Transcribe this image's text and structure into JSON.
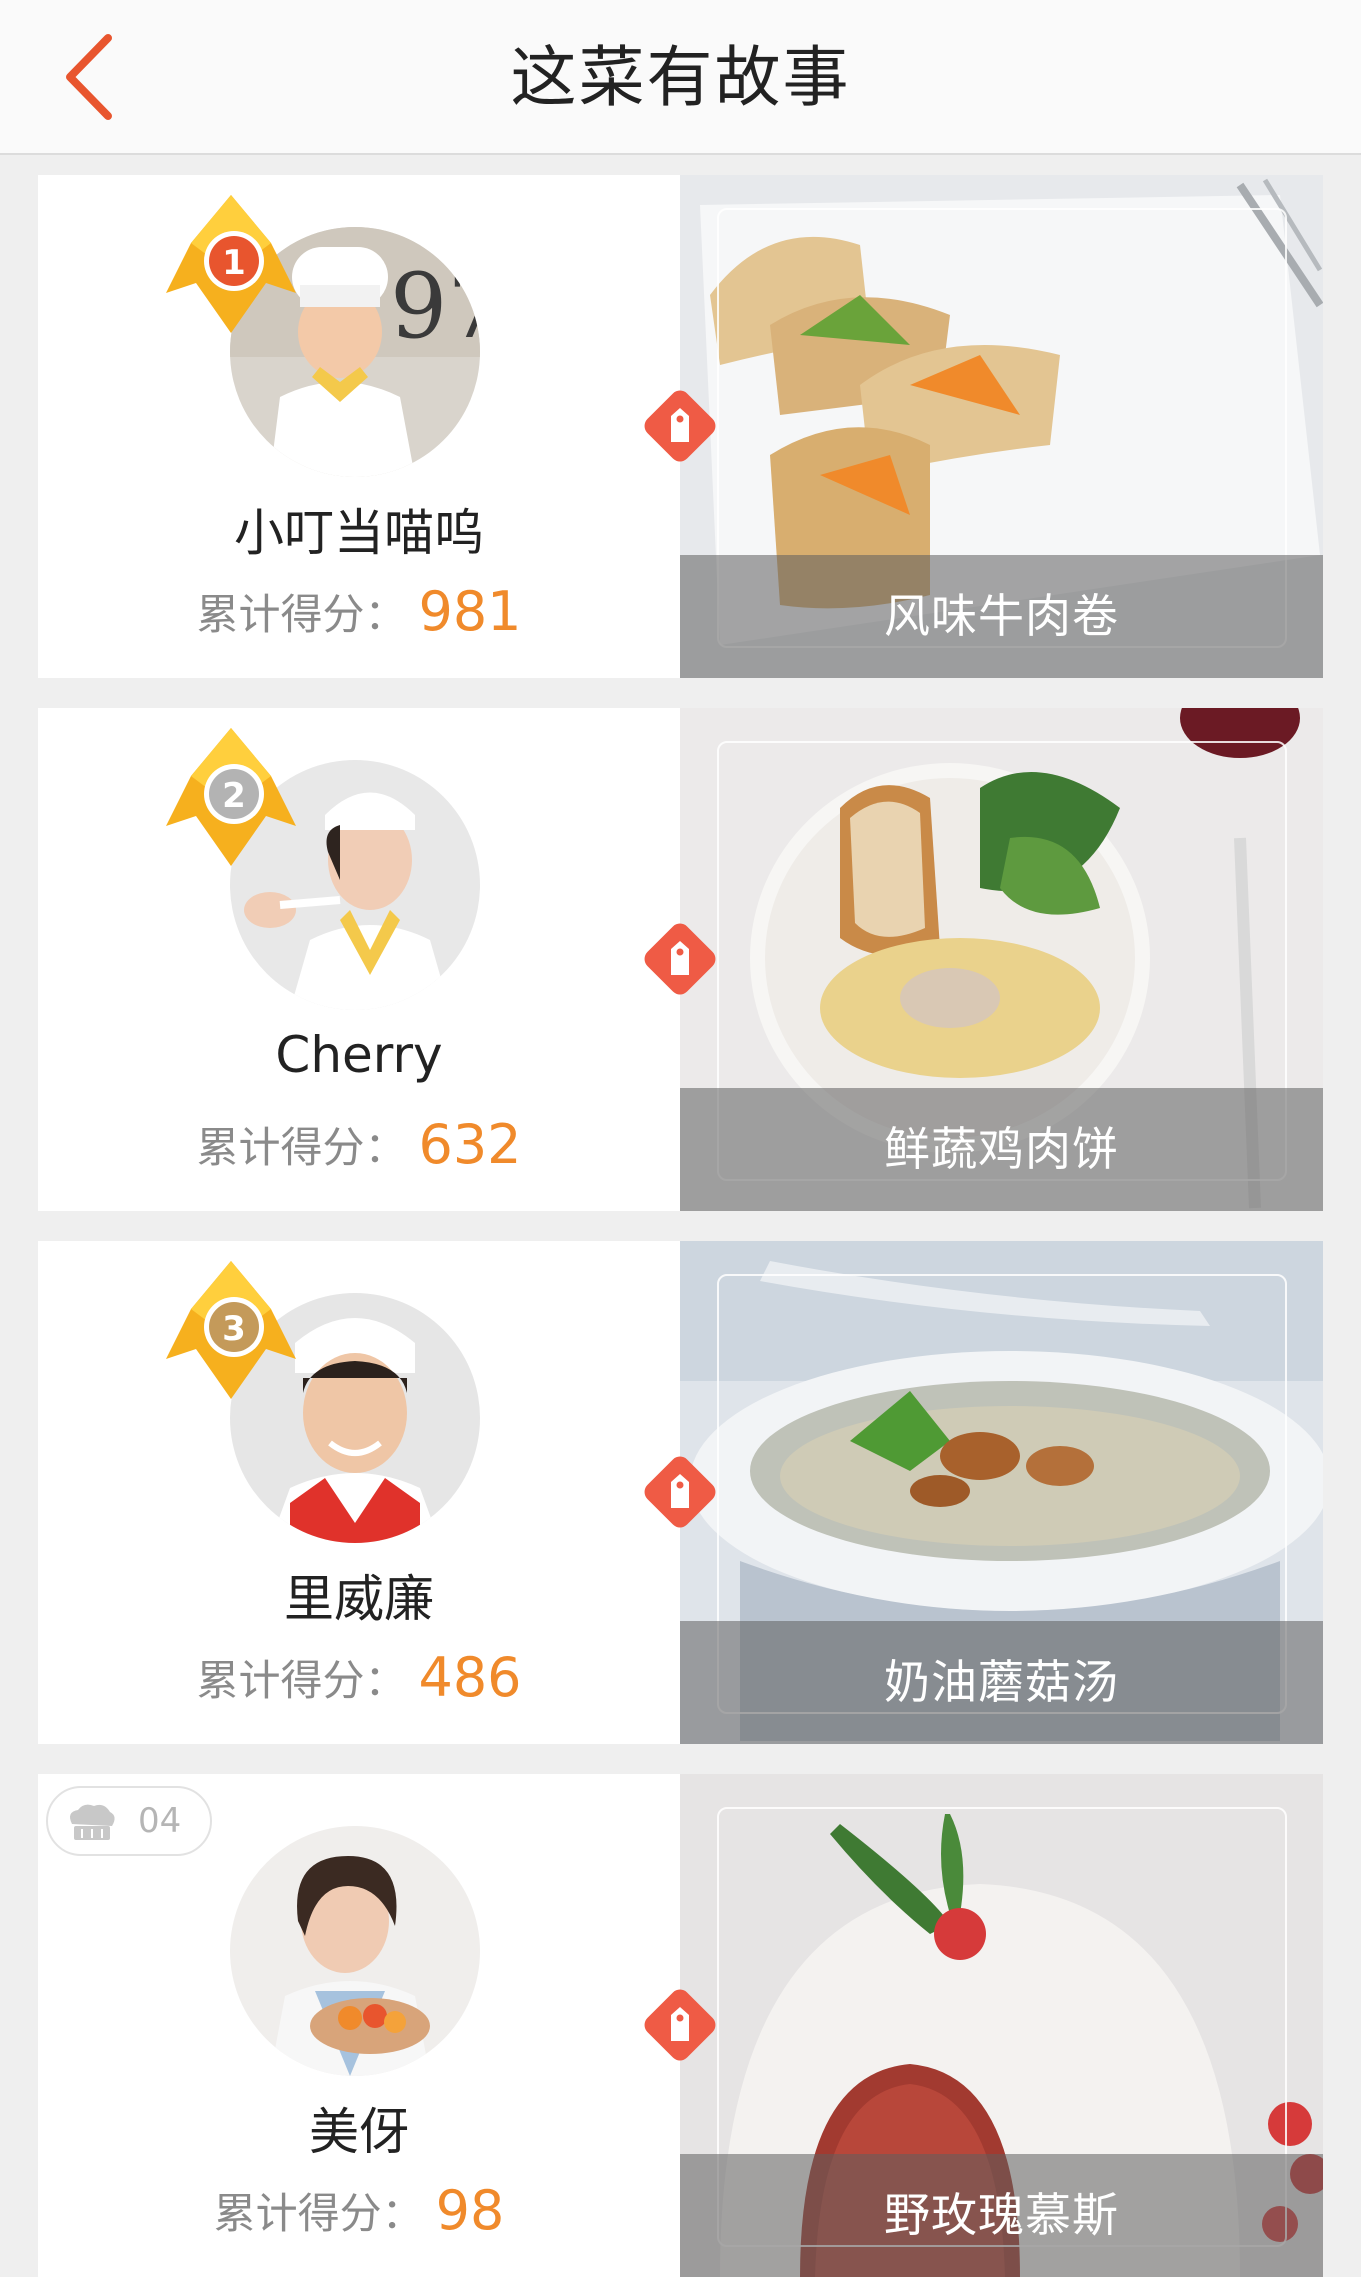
{
  "header": {
    "title": "这菜有故事",
    "back_icon": "chevron-left-icon",
    "accent_color": "#e8552e"
  },
  "entries": [
    {
      "rank": "1",
      "name": "小叮当喵呜",
      "score_label": "累计得分：",
      "score": "981",
      "dish": "风味牛肉卷"
    },
    {
      "rank": "2",
      "name": "Cherry",
      "score_label": "累计得分：",
      "score": "632",
      "dish": "鲜蔬鸡肉饼"
    },
    {
      "rank": "3",
      "name": "里威廉",
      "score_label": "累计得分：",
      "score": "486",
      "dish": "奶油蘑菇汤"
    },
    {
      "rank": "04",
      "name": "美伢",
      "score_label": "累计得分：",
      "score": "98",
      "dish": "野玫瑰慕斯"
    }
  ],
  "colors": {
    "score": "#f08a2b",
    "tag": "#ef5b45",
    "crown": "#f6b01e",
    "rank1_badge": "#e8552e",
    "rank2_badge": "#b3b3b3",
    "rank3_badge": "#c49a5a"
  }
}
